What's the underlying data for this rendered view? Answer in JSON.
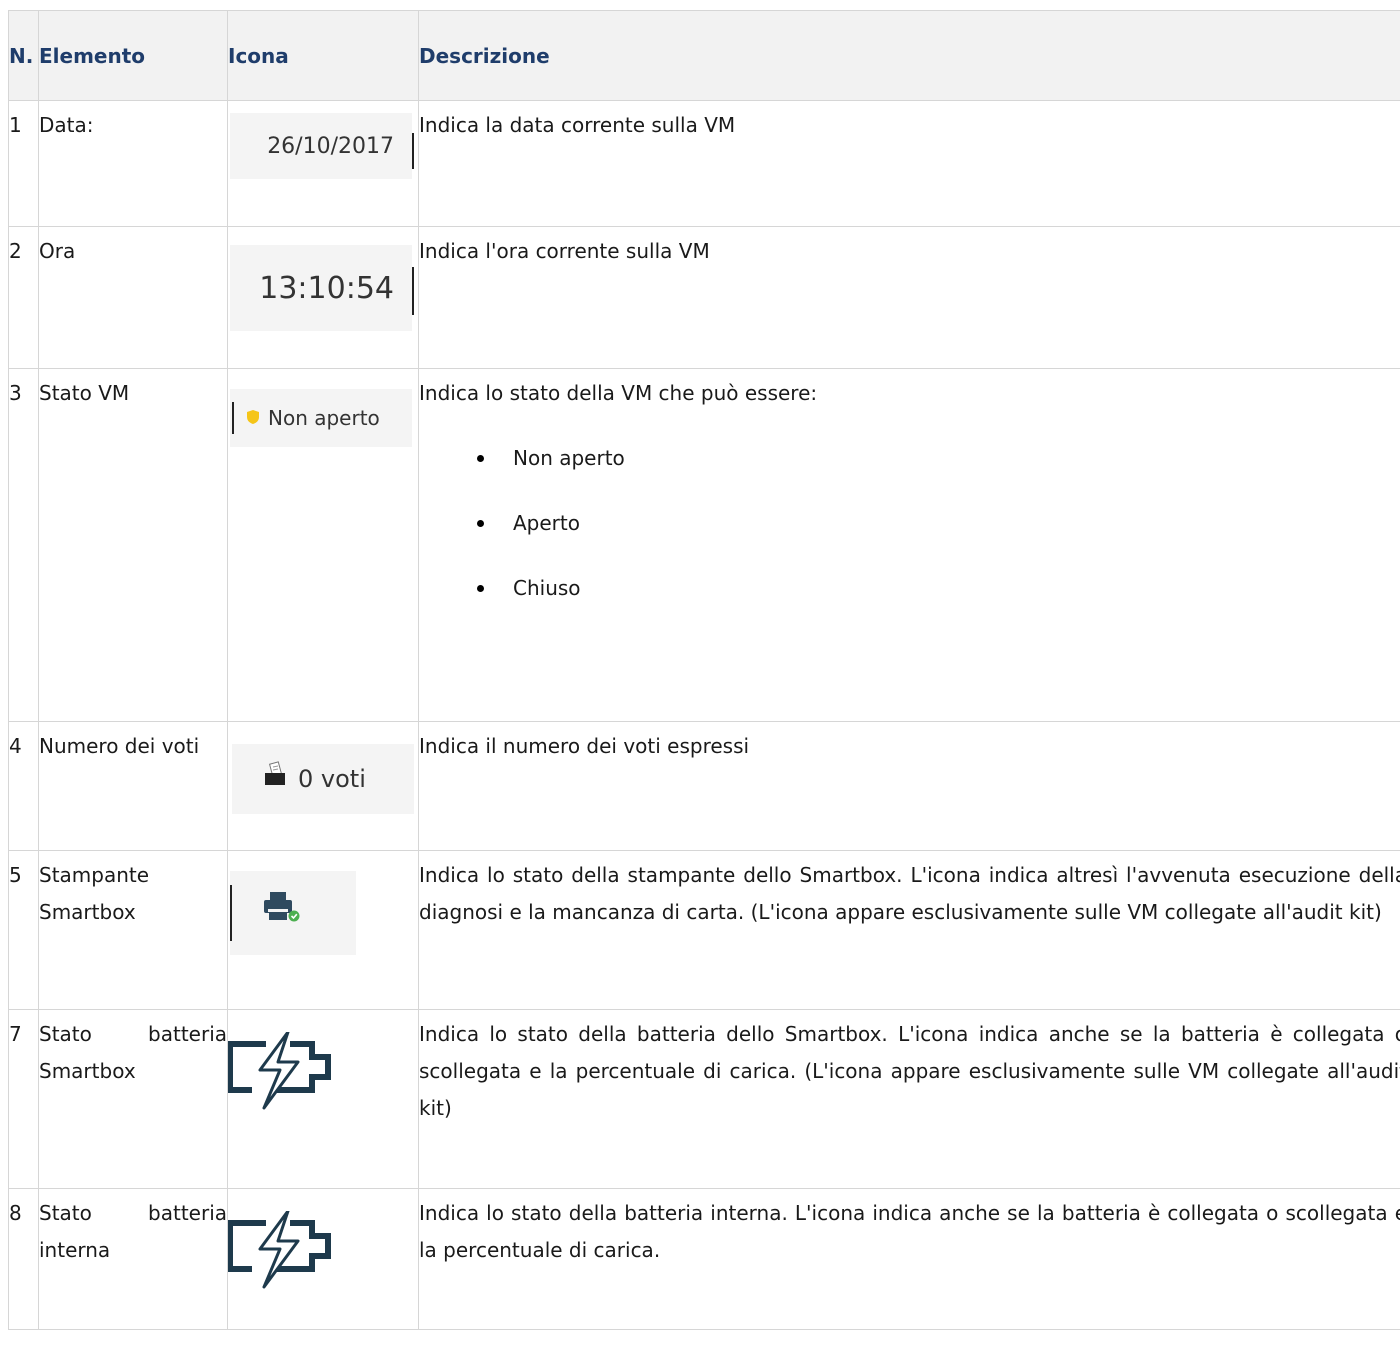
{
  "table": {
    "headers": {
      "num": "N.",
      "element": "Elemento",
      "icon": "Icona",
      "description": "Descrizione"
    },
    "rows": [
      {
        "num": "1",
        "element": "Data:",
        "icon_text": "26/10/2017",
        "description": "Indica la data corrente sulla VM"
      },
      {
        "num": "2",
        "element": "Ora",
        "icon_text": "13:10:54",
        "description": "Indica l'ora corrente sulla VM"
      },
      {
        "num": "3",
        "element": "Stato VM",
        "icon_text": "Non aperto",
        "description": "Indica lo stato della VM che può essere:",
        "states": [
          "Non aperto",
          "Aperto",
          "Chiuso"
        ]
      },
      {
        "num": "4",
        "element": "Numero dei voti",
        "icon_text": "0 voti",
        "description": "Indica il numero dei voti espressi"
      },
      {
        "num": "5",
        "element": "Stampante Smartbox",
        "description": "Indica lo stato della stampante dello Smartbox. L'icona indica altresì l'avvenuta esecuzione della diagnosi e la mancanza di carta. (L'icona appare esclusivamente sulle VM collegate all'audit kit)"
      },
      {
        "num": "7",
        "element": "Stato batteria Smartbox",
        "description": "Indica lo stato della batteria dello Smartbox. L'icona indica anche se la batteria è collegata o scollegata e la percentuale di carica. (L'icona appare esclusivamente sulle VM collegate all'audit kit)"
      },
      {
        "num": "8",
        "element": "Stato batteria interna",
        "description": "Indica lo stato della batteria interna. L'icona indica anche se la batteria è collegata o scollegata e la percentuale di carica."
      }
    ]
  },
  "icons": {
    "status_dot": "shield-icon",
    "ballot": "ballot-box-icon",
    "printer": "printer-icon",
    "battery": "battery-charging-icon"
  },
  "colors": {
    "header_text": "#1f3d6b",
    "status_yellow": "#f5c518",
    "printer_body": "#2f4a5f",
    "printer_check": "#4caf50",
    "battery_stroke": "#1e3a4c"
  }
}
